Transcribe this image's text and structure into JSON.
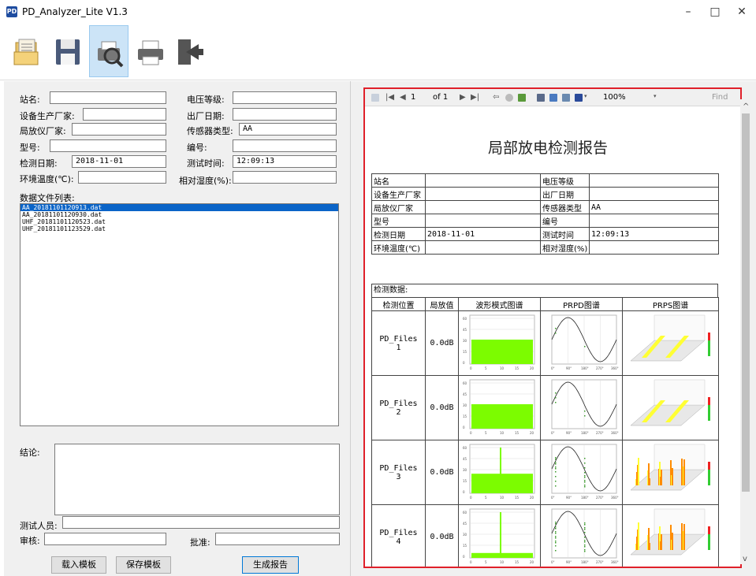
{
  "window": {
    "title": "PD_Analyzer_Lite V1.3",
    "icon_text": "PD",
    "minimize": "–",
    "maximize": "□",
    "close": "✕"
  },
  "toolbar": {
    "buttons": [
      {
        "name": "open-icon",
        "active": false
      },
      {
        "name": "save-icon",
        "active": false
      },
      {
        "name": "print-preview-icon",
        "active": true
      },
      {
        "name": "print-icon",
        "active": false
      },
      {
        "name": "exit-icon",
        "active": false
      }
    ]
  },
  "form": {
    "station_label": "站名:",
    "station_value": "",
    "voltage_label": "电压等级:",
    "voltage_value": "",
    "equip_maker_label": "设备生产厂家:",
    "equip_maker_value": "",
    "factory_date_label": "出厂日期:",
    "factory_date_value": "",
    "pd_maker_label": "局放仪厂家:",
    "pd_maker_value": "",
    "sensor_type_label": "传感器类型:",
    "sensor_type_value": "AA",
    "model_label": "型号:",
    "model_value": "",
    "serial_label": "编号:",
    "serial_value": "",
    "test_date_label": "检测日期:",
    "test_date_value": "2018-11-01",
    "test_time_label": "测试时间:",
    "test_time_value": "12:09:13",
    "temp_label": "环境温度(℃):",
    "temp_value": "",
    "humidity_label": "相对湿度(%):",
    "humidity_value": "",
    "file_list_label": "数据文件列表:",
    "files": [
      "AA_20181101120913.dat",
      "AA_20181101120930.dat",
      "UHF_20181101120523.dat",
      "UHF_20181101123529.dat"
    ],
    "selected_file_index": 0,
    "conclusion_label": "结论:",
    "tester_label": "测试人员:",
    "tester_value": "",
    "reviewer_label": "审核:",
    "reviewer_value": "",
    "approver_label": "批准:",
    "approver_value": "",
    "load_template": "载入模板",
    "save_template": "保存模板",
    "generate_report": "生成报告"
  },
  "viewer": {
    "page_input": "1",
    "page_of": "of 1",
    "zoom": "100%",
    "find": "Find",
    "accent": "#e0202a"
  },
  "report": {
    "title": "局部放电检测报告",
    "info": [
      [
        "站名",
        "",
        "电压等级",
        ""
      ],
      [
        "设备生产厂家",
        "",
        "出厂日期",
        ""
      ],
      [
        "局放仪厂家",
        "",
        "传感器类型",
        "AA"
      ],
      [
        "型号",
        "",
        "编号",
        ""
      ],
      [
        "检测日期",
        "2018-11-01",
        "测试时间",
        "12:09:13"
      ],
      [
        "环境温度(℃)",
        "",
        "相对湿度(%)",
        ""
      ]
    ],
    "data_header": "检测数据:",
    "columns": [
      "检测位置",
      "局放值",
      "波形模式图谱",
      "PRPD图谱",
      "PRPS图谱"
    ],
    "rows": [
      {
        "position": "PD_Files\n1",
        "value": "0.0dB",
        "wave_level": 0.5,
        "spike": 0
      },
      {
        "position": "PD_Files\n2",
        "value": "0.0dB",
        "wave_level": 0.5,
        "spike": 0
      },
      {
        "position": "PD_Files\n3",
        "value": "0.0dB",
        "wave_level": 0.4,
        "spike": 1
      },
      {
        "position": "PD_Files\n4",
        "value": "0.0dB",
        "wave_level": 0.1,
        "spike": 1
      }
    ],
    "chart_colors": {
      "wave": "#7cfc00",
      "prps_a": "#ffff33",
      "prps_b": "#ff8c00"
    },
    "wave_y_ticks": [
      "60",
      "45",
      "30",
      "15",
      "0"
    ],
    "wave_x_ticks": [
      "0",
      "5",
      "10",
      "15",
      "20"
    ],
    "prpd_x_ticks": [
      "0°",
      "90°",
      "180°",
      "270°",
      "360°"
    ]
  }
}
